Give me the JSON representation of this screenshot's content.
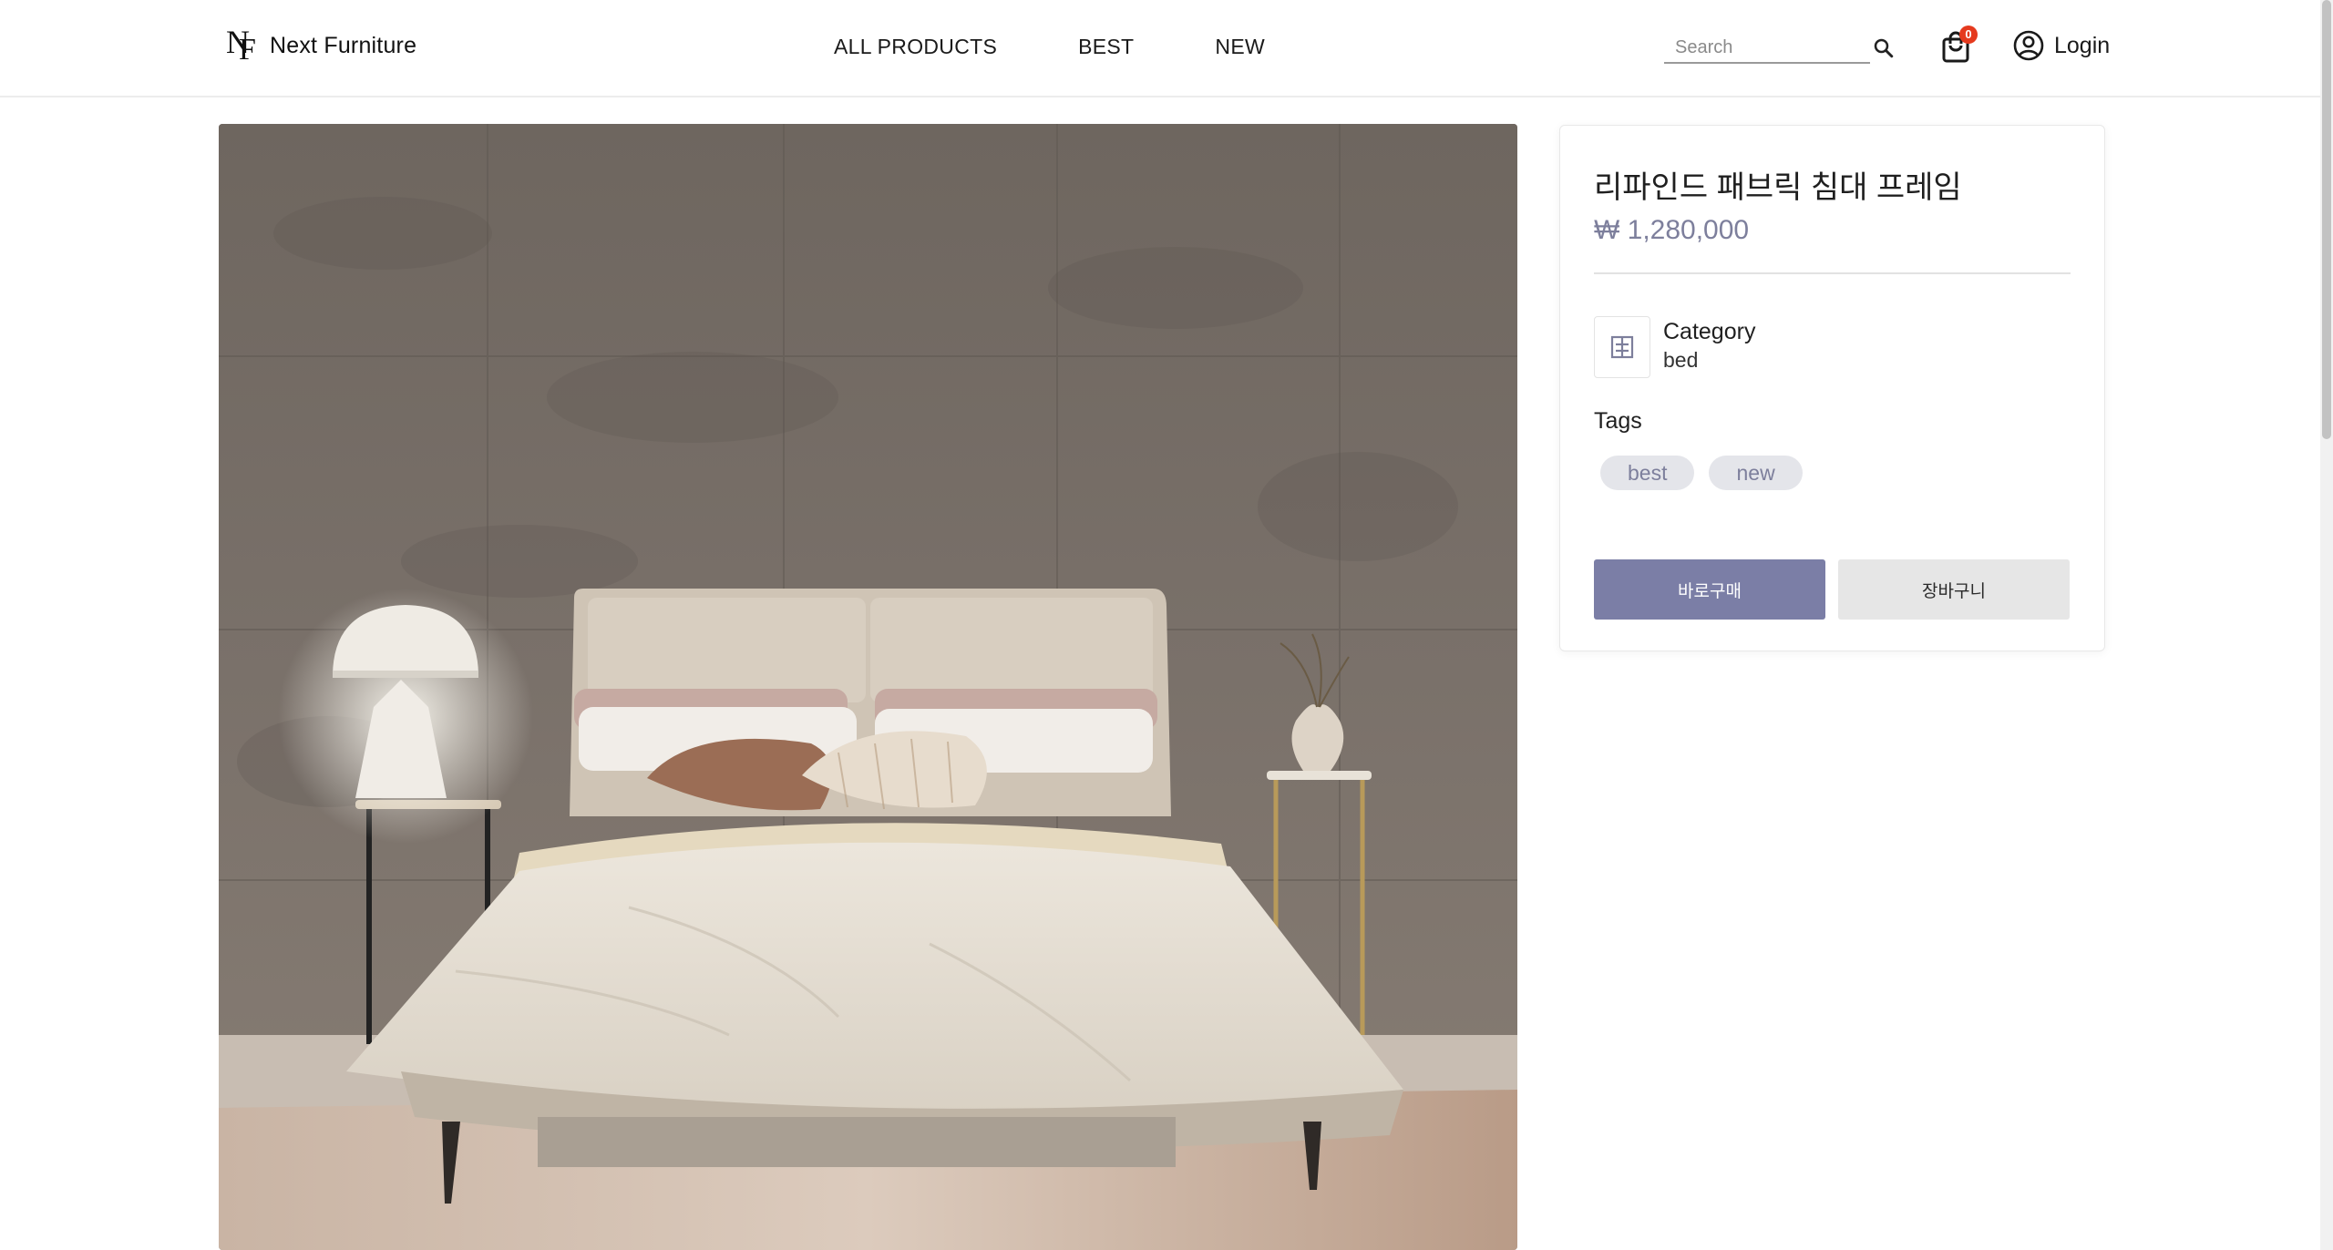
{
  "header": {
    "brand": "Next Furniture",
    "logo_mark_n": "N",
    "logo_mark_f": "F",
    "nav": [
      "ALL PRODUCTS",
      "BEST",
      "NEW"
    ],
    "search_placeholder": "Search",
    "cart_count": "0",
    "login_label": "Login"
  },
  "product": {
    "name": "리파인드 패브릭 침대 프레임",
    "price": "₩ 1,280,000",
    "category_label": "Category",
    "category_value": "bed",
    "tags_label": "Tags",
    "tags": [
      "best",
      "new"
    ],
    "buy_now_label": "바로구매",
    "add_to_cart_label": "장바구니",
    "image_subject": "bed-frame-photo"
  },
  "colors": {
    "accent": "#7b7ea6",
    "price": "#7d7f9c",
    "tag_bg": "#e4e5ea",
    "badge": "#e53a1e"
  },
  "icons": {
    "search": "search-icon",
    "cart": "shopping-bag-icon",
    "login": "user-circle-icon",
    "category": "category-icon"
  }
}
